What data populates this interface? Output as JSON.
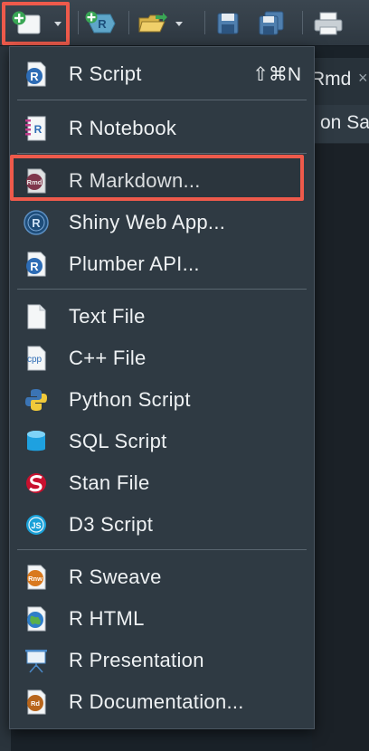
{
  "toolbar": {
    "buttons": [
      {
        "name": "new-file",
        "icon": "new-file-plus-icon"
      },
      {
        "name": "new-project",
        "icon": "r-project-plus-icon"
      },
      {
        "name": "open-file",
        "icon": "folder-open-icon"
      },
      {
        "name": "save",
        "icon": "save-icon"
      },
      {
        "name": "save-all",
        "icon": "save-all-icon"
      },
      {
        "name": "print",
        "icon": "print-icon"
      }
    ]
  },
  "editor": {
    "tab_label": "Rmd",
    "tab_close": "×",
    "source_bar_text": "on Sa"
  },
  "menu": {
    "items": [
      {
        "label": "R Script",
        "shortcut": "⇧⌘N",
        "icon": "r-script-icon"
      },
      {
        "label": "R Notebook",
        "icon": "r-notebook-icon"
      },
      {
        "label": "R Markdown...",
        "icon": "r-markdown-icon",
        "icon_text": "Rmd",
        "highlighted": true
      },
      {
        "label": "Shiny Web App...",
        "icon": "shiny-icon"
      },
      {
        "label": "Plumber API...",
        "icon": "plumber-icon"
      },
      {
        "label": "Text File",
        "icon": "text-file-icon"
      },
      {
        "label": "C++ File",
        "icon": "cpp-file-icon",
        "icon_text": "cpp"
      },
      {
        "label": "Python Script",
        "icon": "python-icon"
      },
      {
        "label": "SQL Script",
        "icon": "sql-icon"
      },
      {
        "label": "Stan File",
        "icon": "stan-icon"
      },
      {
        "label": "D3 Script",
        "icon": "d3-icon",
        "icon_text": "JS"
      },
      {
        "label": "R Sweave",
        "icon": "r-sweave-icon",
        "icon_text": "Rnw"
      },
      {
        "label": "R HTML",
        "icon": "r-html-icon"
      },
      {
        "label": "R Presentation",
        "icon": "r-presentation-icon"
      },
      {
        "label": "R Documentation...",
        "icon": "r-documentation-icon",
        "icon_text": "Rd"
      }
    ]
  },
  "colors": {
    "highlight": "#ee5a4b",
    "menu_bg": "#2f3a43",
    "menu_text": "#eef1f3",
    "r_blue": "#2d6cb5"
  }
}
